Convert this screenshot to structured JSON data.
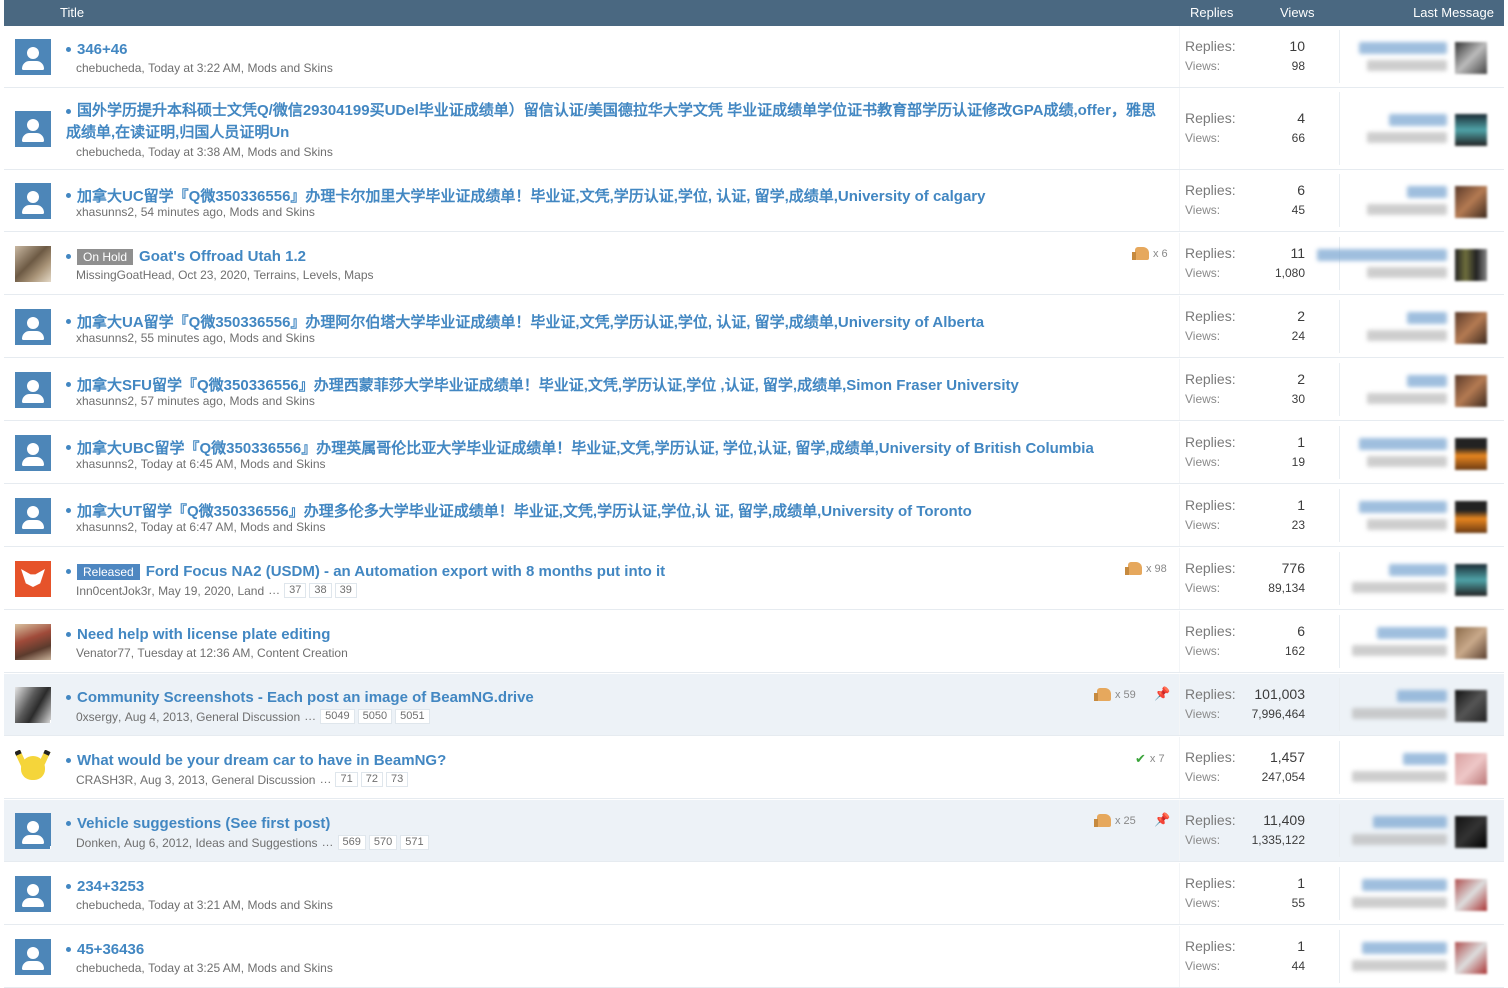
{
  "header": {
    "title": "Title",
    "replies": "Replies",
    "views": "Views",
    "last_message": "Last Message"
  },
  "labels": {
    "replies": "Replies:",
    "views": "Views:"
  },
  "threads": [
    {
      "title": "346+46",
      "author": "chebucheda",
      "date": "Today at 3:22 AM",
      "forum": "Mods and Skins",
      "replies": "10",
      "views": "98"
    },
    {
      "title": "国外学历提升本科硕士文凭Q/微信29304199买UDel毕业证成绩单）留信认证/美国德拉华大学文凭 毕业证成绩单学位证书教育部学历认证修改GPA成绩,offer，雅思成绩单,在读证明,归国人员证明Un",
      "author": "chebucheda",
      "date": "Today at 3:38 AM",
      "forum": "Mods and Skins",
      "replies": "4",
      "views": "66"
    },
    {
      "title": "加拿大UC留学『Q微350336556』办理卡尔加里大学毕业证成绩单！毕业证,文凭,学历认证,学位, 认证, 留学,成绩单,University of calgary",
      "author": "xhasunns2",
      "date": "54 minutes ago",
      "forum": "Mods and Skins",
      "replies": "6",
      "views": "45"
    },
    {
      "prefix": "On Hold",
      "title": "Goat's Offroad Utah 1.2",
      "author": "MissingGoatHead",
      "date": "Oct 23, 2020",
      "forum": "Terrains, Levels, Maps",
      "likes": "x 6",
      "replies": "11",
      "views": "1,080"
    },
    {
      "title": "加拿大UA留学『Q微350336556』办理阿尔伯塔大学毕业证成绩单！毕业证,文凭,学历认证,学位, 认证, 留学,成绩单,University of Alberta",
      "author": "xhasunns2",
      "date": "55 minutes ago",
      "forum": "Mods and Skins",
      "replies": "2",
      "views": "24"
    },
    {
      "title": "加拿大SFU留学『Q微350336556』办理西蒙菲莎大学毕业证成绩单！毕业证,文凭,学历认证,学位 ,认证, 留学,成绩单,Simon Fraser University",
      "author": "xhasunns2",
      "date": "57 minutes ago",
      "forum": "Mods and Skins",
      "replies": "2",
      "views": "30"
    },
    {
      "title": "加拿大UBC留学『Q微350336556』办理英属哥伦比亚大学毕业证成绩单！毕业证,文凭,学历认证, 学位,认证, 留学,成绩单,University of British Columbia",
      "author": "xhasunns2",
      "date": "Today at 6:45 AM",
      "forum": "Mods and Skins",
      "replies": "1",
      "views": "19"
    },
    {
      "title": "加拿大UT留学『Q微350336556』办理多伦多大学毕业证成绩单！毕业证,文凭,学历认证,学位,认 证, 留学,成绩单,University of Toronto",
      "author": "xhasunns2",
      "date": "Today at 6:47 AM",
      "forum": "Mods and Skins",
      "replies": "1",
      "views": "23"
    },
    {
      "prefix": "Released",
      "title": "Ford Focus NA2 (USDM) - an Automation export with 8 months put into it",
      "author": "Inn0centJok3r",
      "date": "May 19, 2020",
      "forum": "Land",
      "likes": "x 98",
      "pages": [
        "37",
        "38",
        "39"
      ],
      "replies": "776",
      "views": "89,134"
    },
    {
      "title": "Need help with license plate editing",
      "author": "Venator77",
      "date": "Tuesday at 12:36 AM",
      "forum": "Content Creation",
      "replies": "6",
      "views": "162"
    },
    {
      "title": "Community Screenshots - Each post an image of BeamNG.drive",
      "author": "0xsergy",
      "date": "Aug 4, 2013",
      "forum": "General Discussion",
      "likes": "x 59",
      "pages": [
        "5049",
        "5050",
        "5051"
      ],
      "replies": "101,003",
      "views": "7,996,464"
    },
    {
      "title": "What would be your dream car to have in BeamNG?",
      "author": "CRASH3R",
      "date": "Aug 3, 2013",
      "forum": "General Discussion",
      "likes": "x 7",
      "pages": [
        "71",
        "72",
        "73"
      ],
      "replies": "1,457",
      "views": "247,054"
    },
    {
      "title": "Vehicle suggestions (See first post)",
      "author": "Donken",
      "date": "Aug 6, 2012",
      "forum": "Ideas and Suggestions",
      "likes": "x 25",
      "pages": [
        "569",
        "570",
        "571"
      ],
      "replies": "11,409",
      "views": "1,335,122"
    },
    {
      "title": "234+3253",
      "author": "chebucheda",
      "date": "Today at 3:21 AM",
      "forum": "Mods and Skins",
      "replies": "1",
      "views": "55"
    },
    {
      "title": "45+36436",
      "author": "chebucheda",
      "date": "Today at 3:25 AM",
      "forum": "Mods and Skins",
      "replies": "1",
      "views": "44"
    }
  ],
  "colors": {
    "header_bg": "#4a6881",
    "link": "#4287c2",
    "sticky_bg": "#edf2f7"
  }
}
